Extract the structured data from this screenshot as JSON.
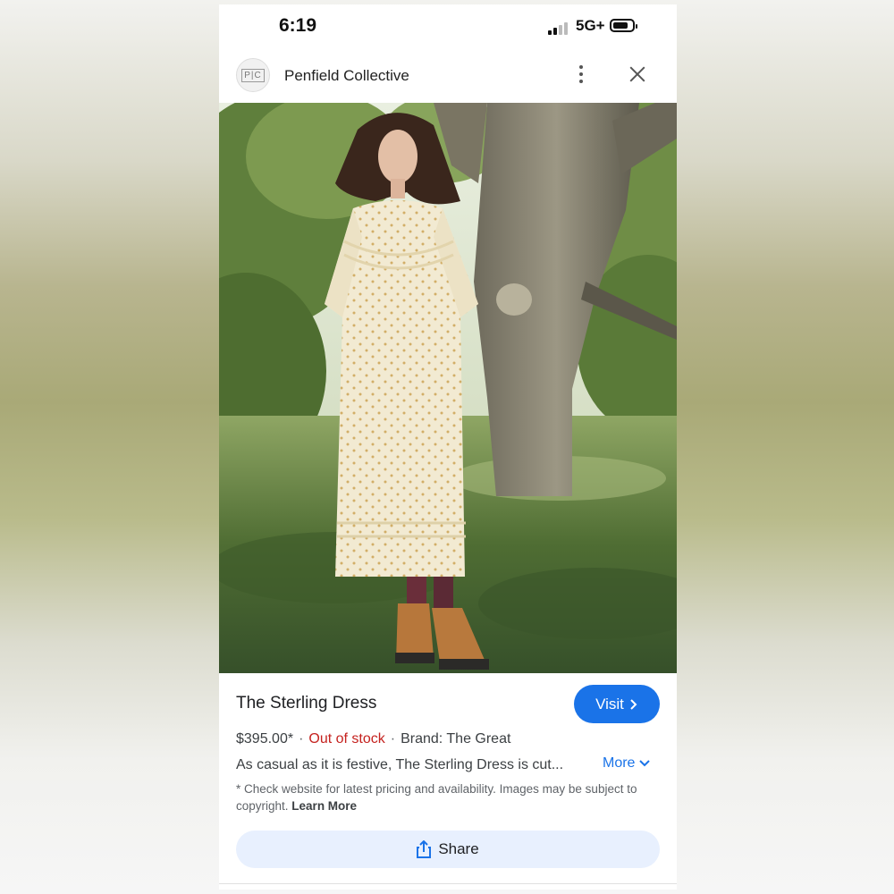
{
  "status_bar": {
    "time": "6:19",
    "network": "5G+"
  },
  "header": {
    "logo_text": "P|C",
    "site_name": "Penfield Collective"
  },
  "product": {
    "title": "The Sterling Dress",
    "visit_label": "Visit",
    "price": "$395.00*",
    "stock_status": "Out of stock",
    "brand": "Brand: The Great",
    "description": "As casual as it is festive, The Sterling Dress is cut...",
    "more_label": "More",
    "disclaimer": "* Check website for latest pricing and availability. Images may be subject to copyright.",
    "learn_more_label": "Learn More",
    "share_label": "Share"
  },
  "colors": {
    "accent": "#1a73e8",
    "out_of_stock": "#c5221f",
    "share_bg": "#e8f0fe"
  },
  "icons": {
    "kebab": "more-vert-icon",
    "close": "close-icon",
    "visit": "chevron-right-icon",
    "more": "chevron-down-icon",
    "share": "share-icon"
  }
}
